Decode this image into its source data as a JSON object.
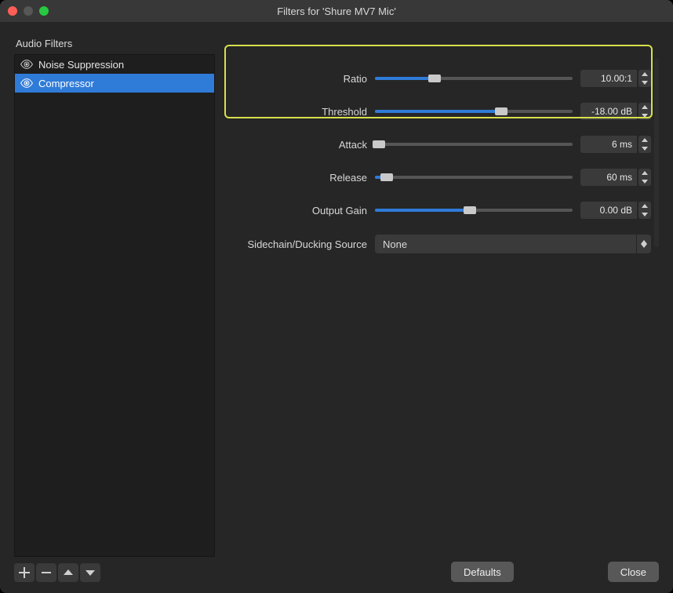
{
  "window": {
    "title": "Filters for 'Shure MV7 Mic'"
  },
  "section_label": "Audio Filters",
  "filters": [
    {
      "name": "Noise Suppression",
      "selected": false
    },
    {
      "name": "Compressor",
      "selected": true
    }
  ],
  "controls": {
    "ratio": {
      "label": "Ratio",
      "value": "10.00:1",
      "fill_pct": 30
    },
    "threshold": {
      "label": "Threshold",
      "value": "-18.00 dB",
      "fill_pct": 64
    },
    "attack": {
      "label": "Attack",
      "value": "6 ms",
      "fill_pct": 2
    },
    "release": {
      "label": "Release",
      "value": "60 ms",
      "fill_pct": 6
    },
    "outputgain": {
      "label": "Output Gain",
      "value": "0.00 dB",
      "fill_pct": 48
    }
  },
  "sidechain": {
    "label": "Sidechain/Ducking Source",
    "value": "None"
  },
  "buttons": {
    "defaults": "Defaults",
    "close": "Close"
  }
}
